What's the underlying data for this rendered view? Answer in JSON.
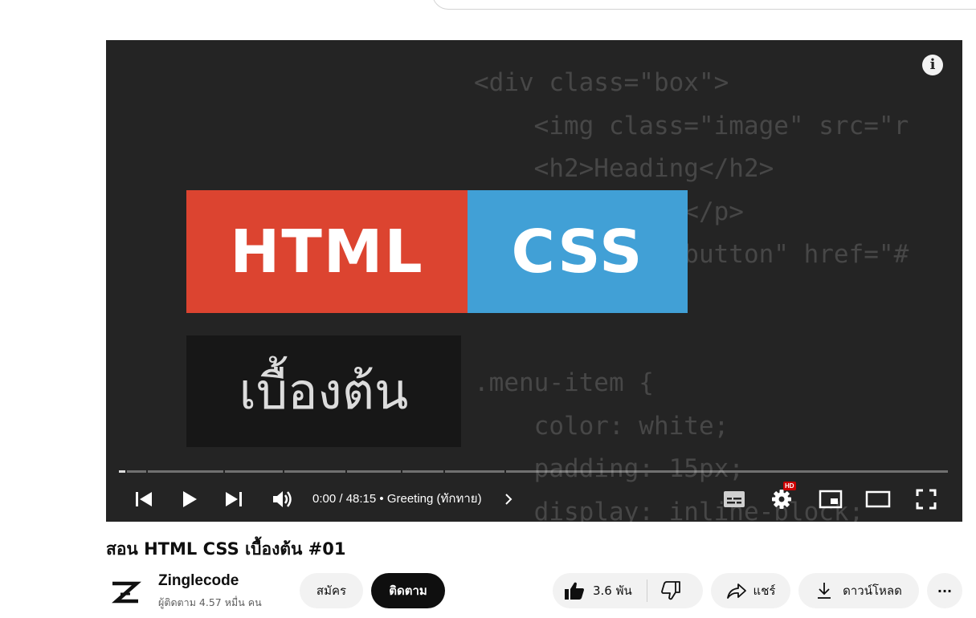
{
  "player": {
    "code_lines_top": [
      "<div class=\"box\">",
      "    <img class=\"image\" src=\"r",
      "    <h2>Heading</h2>",
      "    <p>Content</p>",
      "    <a class=\"button\" href=\"#"
    ],
    "code_lines_bottom": [
      ".menu-item {",
      "    color: white;",
      "    padding: 15px;",
      "    display: inline-block;"
    ],
    "thumbnail": {
      "word1": "HTML",
      "word2": "CSS",
      "word3": "เบื้องต้น"
    },
    "info_icon": "info-icon",
    "progress_fraction": 0.0,
    "time_text": "0:00 / 48:15",
    "chapter": "Greeting (ทักทาย)",
    "hd_badge": "HD"
  },
  "video": {
    "title": "สอน HTML CSS เบื้องต้น #01",
    "channel_name": "Zinglecode",
    "subscribers": "ผู้ติดตาม 4.57 หมื่น คน"
  },
  "actions": {
    "join_label": "สมัคร",
    "subscribe_label": "ติดตาม",
    "like_count": "3.6 พัน",
    "share_label": "แชร์",
    "download_label": "ดาวน์โหลด",
    "more_label": "···"
  },
  "colors": {
    "html_red": "#dc4430",
    "css_blue": "#41a0d6",
    "accent_red": "#cc0000"
  }
}
